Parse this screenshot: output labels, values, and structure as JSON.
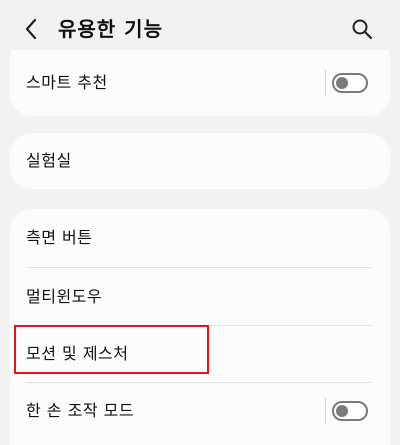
{
  "header": {
    "title": "유용한 기능",
    "back_icon": "chevron-left-icon",
    "search_icon": "search-icon"
  },
  "sections": [
    {
      "items": [
        {
          "label": "스마트 추천",
          "toggle": false
        }
      ]
    },
    {
      "items": [
        {
          "label": "실험실"
        }
      ]
    },
    {
      "items": [
        {
          "label": "측면 버튼"
        },
        {
          "label": "멀티윈도우"
        },
        {
          "label": "모션 및 제스처",
          "highlighted": true
        },
        {
          "label": "한 손 조작 모드",
          "toggle": false
        }
      ]
    }
  ],
  "colors": {
    "background": "#f2f2f2",
    "card": "#fcfcfc",
    "highlight": "#e8141b",
    "toggle_off": "#7a7a7a"
  }
}
